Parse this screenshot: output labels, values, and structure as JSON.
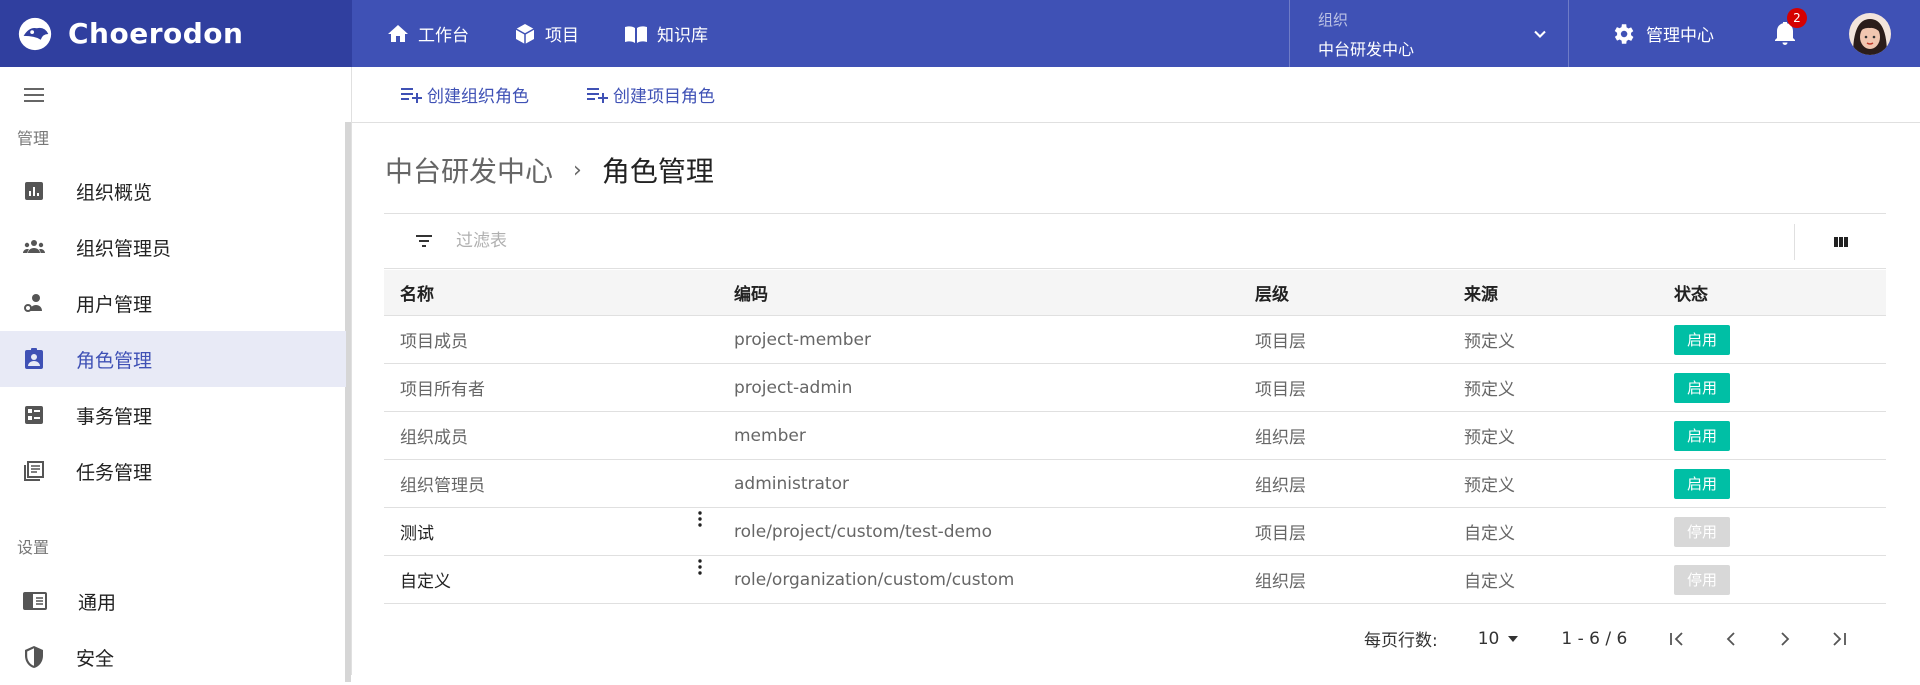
{
  "app": {
    "brand": "Choerodon",
    "nav": [
      {
        "label": "工作台",
        "icon": "home-icon"
      },
      {
        "label": "项目",
        "icon": "cube-icon"
      },
      {
        "label": "知识库",
        "icon": "book-icon"
      }
    ],
    "org": {
      "label": "组织",
      "value": "中台研发中心"
    },
    "admin_center": "管理中心",
    "notifications": "2"
  },
  "sidebar": {
    "section_manage": "管理",
    "items": [
      {
        "label": "组织概览",
        "icon": "bar-chart-icon"
      },
      {
        "label": "组织管理员",
        "icon": "group-icon"
      },
      {
        "label": "用户管理",
        "icon": "user-settings-icon"
      },
      {
        "label": "角色管理",
        "icon": "badge-icon",
        "active": true
      },
      {
        "label": "事务管理",
        "icon": "list-alt-icon"
      },
      {
        "label": "任务管理",
        "icon": "task-icon"
      }
    ],
    "section_settings": "设置",
    "settings_items": [
      {
        "label": "通用",
        "icon": "panel-icon"
      },
      {
        "label": "安全",
        "icon": "shield-icon"
      }
    ]
  },
  "actions": {
    "create_org_role": "创建组织角色",
    "create_project_role": "创建项目角色"
  },
  "breadcrumb": {
    "parent": "中台研发中心",
    "separator": "›",
    "current": "角色管理"
  },
  "filter": {
    "placeholder": "过滤表"
  },
  "table": {
    "columns": [
      "名称",
      "编码",
      "层级",
      "来源",
      "状态"
    ],
    "rows": [
      {
        "name": "项目成员",
        "code": "project-member",
        "level": "项目层",
        "source": "预定义",
        "status": "启用",
        "enabled": true
      },
      {
        "name": "项目所有者",
        "code": "project-admin",
        "level": "项目层",
        "source": "预定义",
        "status": "启用",
        "enabled": true
      },
      {
        "name": "组织成员",
        "code": "member",
        "level": "组织层",
        "source": "预定义",
        "status": "启用",
        "enabled": true
      },
      {
        "name": "组织管理员",
        "code": "administrator",
        "level": "组织层",
        "source": "预定义",
        "status": "启用",
        "enabled": true
      },
      {
        "name": "测试",
        "code": "role/project/custom/test-demo",
        "level": "项目层",
        "source": "自定义",
        "status": "停用",
        "enabled": false
      },
      {
        "name": "自定义",
        "code": "role/organization/custom/custom",
        "level": "组织层",
        "source": "自定义",
        "status": "停用",
        "enabled": false
      }
    ]
  },
  "pagination": {
    "per_page_label": "每页行数:",
    "per_page": "10",
    "range": "1 - 6 / 6"
  },
  "colors": {
    "primary": "#3f51b5",
    "brand_bg": "#303f9f",
    "enabled": "#00bfa5",
    "disabled": "#d8d8d8",
    "active_bg": "#e8eaf6"
  }
}
